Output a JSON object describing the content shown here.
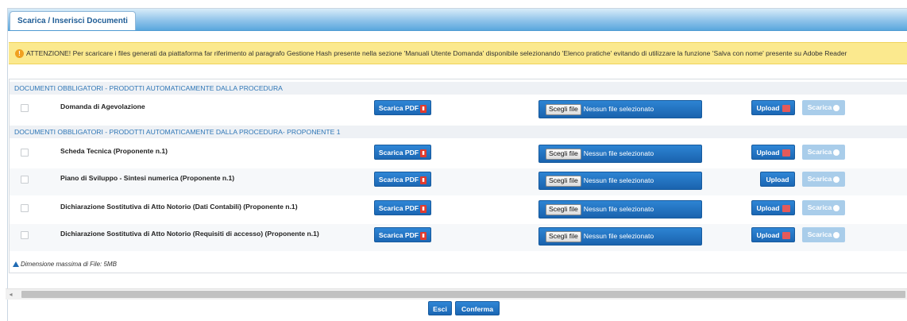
{
  "tab": {
    "label": "Scarica / Inserisci Documenti"
  },
  "warning": {
    "icon": "warning-icon",
    "text": "ATTENZIONE! Per scaricare i files generati da piattaforma far riferimento al paragrafo Gestione Hash presente nella sezione 'Manuali Utente Domanda' disponibile selezionando 'Elenco pratiche' evitando di utilizzare la funzione 'Salva con nome' presente su Adobe Reader"
  },
  "sections": [
    {
      "title": "DOCUMENTI OBBLIGATORI - PRODOTTI AUTOMATICAMENTE DALLA PROCEDURA"
    },
    {
      "title": "DOCUMENTI OBBLIGATORI - PRODOTTI AUTOMATICAMENTE DALLA PROCEDURA- PROPONENTE 1"
    }
  ],
  "rows": [
    {
      "label": "Domanda di Agevolazione"
    },
    {
      "label": "Scheda Tecnica (Proponente n.1)"
    },
    {
      "label": "Piano di Sviluppo - Sintesi numerica (Proponente n.1)"
    },
    {
      "label": "Dichiarazione Sostitutiva di Atto Notorio (Dati Contabili) (Proponente n.1)"
    },
    {
      "label": "Dichiarazione Sostitutiva di Atto Notorio (Requisiti di accesso) (Proponente n.1)"
    }
  ],
  "buttons": {
    "scarica_pdf": "Scarica PDF",
    "choose_file": "Scegli file",
    "no_file": "Nessun file selezionato",
    "upload": "Upload",
    "scarica": "Scarica"
  },
  "note": "Dimensione massima di File: 5MB",
  "footer": {
    "exit": "Esci",
    "confirm": "Conferma"
  },
  "colors": {
    "primary": "#1f6ab3",
    "warning_bg": "#fbe98e",
    "section_text": "#2e76b6"
  }
}
